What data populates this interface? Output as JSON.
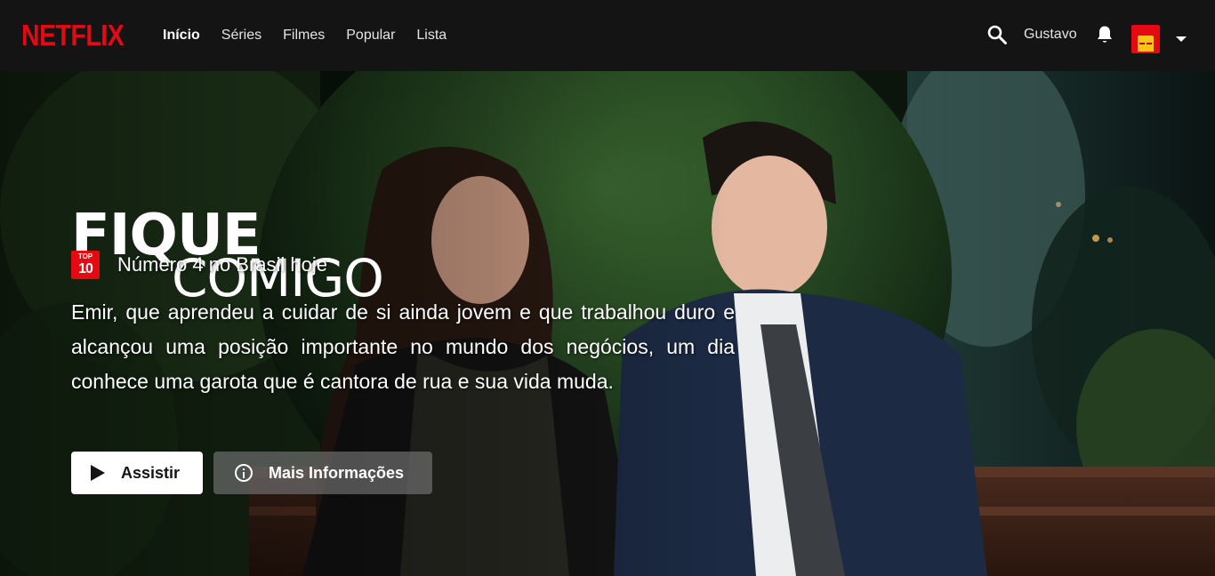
{
  "brand": {
    "logo_text": "NETFLIX",
    "accent_color": "#e50914"
  },
  "nav": {
    "links": [
      {
        "label": "Início",
        "active": true
      },
      {
        "label": "Séries",
        "active": false
      },
      {
        "label": "Filmes",
        "active": false
      },
      {
        "label": "Popular",
        "active": false
      },
      {
        "label": "Lista",
        "active": false
      }
    ],
    "user_name": "Gustavo",
    "icons": [
      "search-icon",
      "bell-icon",
      "avatar",
      "caret-down-icon"
    ]
  },
  "hero": {
    "title_line1": "FIQUE",
    "title_line2": "COMIGO",
    "badge_top": "TOP",
    "badge_num": "10",
    "rank_text": "Número 4 no Brasil hoje",
    "synopsis": "Emir, que aprendeu a cuidar de si ainda jovem e que trabalhou duro e alcançou uma posição importante no mundo dos negócios, um dia conhece uma garota que é cantora de rua e sua vida muda.",
    "play_label": "Assistir",
    "info_label": "Mais Informações"
  }
}
